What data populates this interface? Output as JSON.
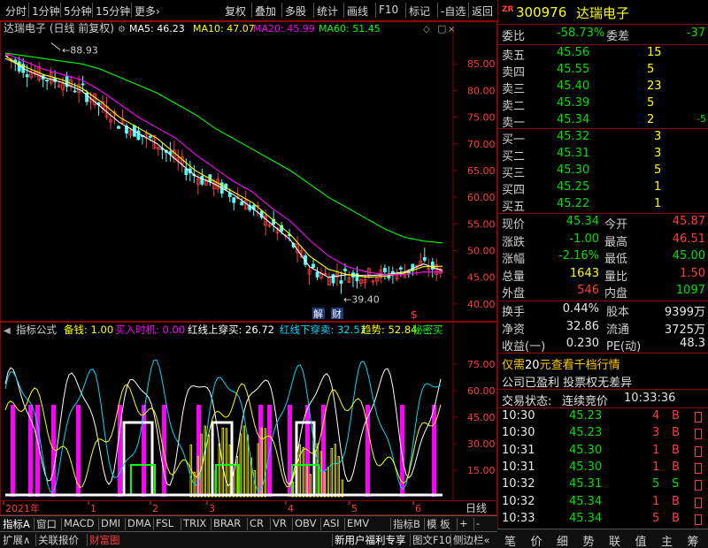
{
  "toolbar": {
    "items": [
      "分时",
      "1分钟",
      "5分钟",
      "15分钟",
      "更多›",
      "复权",
      "叠加",
      "多股",
      "统计",
      "画线",
      "F10",
      "标记",
      "-自选",
      "返回"
    ]
  },
  "kline": {
    "title": "达瑞电子 (日线 前复权)",
    "ma": [
      {
        "label": "MA5: 46.23",
        "color": "#ffffff"
      },
      {
        "label": "MA10: 47.07",
        "color": "#ffff00"
      },
      {
        "label": "MA20: 45.99",
        "color": "#ff00ff"
      },
      {
        "label": "MA60: 51.45",
        "color": "#00ff00"
      }
    ],
    "price_ticks": [
      "85.00",
      "80.00",
      "75.00",
      "70.00",
      "65.00",
      "60.00",
      "55.00",
      "50.00",
      "45.00",
      "40.00"
    ],
    "high_label": "88.93",
    "low_label": "39.40",
    "markers": [
      "解",
      "财",
      "$"
    ]
  },
  "chart_data": {
    "type": "line",
    "title": "达瑞电子 (日线 前复权)",
    "ylim": [
      38,
      90
    ],
    "x": [
      "2021年",
      "1",
      "2",
      "3",
      "4",
      "5",
      "6"
    ],
    "series": [
      {
        "name": "MA5",
        "values": [
          86.5,
          84,
          82.5,
          81.5,
          80,
          77,
          74,
          72,
          70,
          67,
          64,
          62.5,
          60.5,
          58,
          55,
          52,
          47,
          45,
          45.5,
          45.3,
          45.5,
          46,
          47.5,
          46.23
        ]
      },
      {
        "name": "MA10",
        "values": [
          86,
          84.5,
          83,
          82,
          80.5,
          78,
          75,
          73,
          71,
          68,
          65,
          63,
          61,
          59,
          56,
          53,
          49,
          46.5,
          45.5,
          45,
          45.2,
          45.8,
          47,
          47.07
        ]
      },
      {
        "name": "MA20",
        "values": [
          87,
          85.5,
          84,
          83,
          82,
          80,
          77.5,
          75,
          73,
          71,
          68,
          65.5,
          63,
          61,
          58,
          55.5,
          52,
          49,
          47,
          46,
          45.5,
          45.5,
          46,
          45.99
        ]
      },
      {
        "name": "MA60",
        "values": [
          87,
          86.5,
          86,
          85.5,
          85,
          84,
          82.5,
          81,
          79.5,
          77.5,
          75.5,
          73,
          71,
          69,
          67,
          65,
          62.5,
          60,
          58,
          56,
          54,
          52.5,
          51.8,
          51.45
        ]
      }
    ]
  },
  "indicator": {
    "name": "指标公式",
    "items": [
      {
        "label": "备钱: 1.00",
        "color": "#ffff00"
      },
      {
        "label": "买入时机: 0.00",
        "color": "#ff00ff"
      },
      {
        "label": "红线上穿买: 26.72",
        "color": "#ffffff"
      },
      {
        "label": "红线下穿卖: 32.51",
        "color": "#00d8ff"
      },
      {
        "label": "趋势: 52.84",
        "color": "#ffff00"
      },
      {
        "label": "秘密买",
        "color": "#00ff00"
      }
    ],
    "ticks": [
      "75.00",
      "60.00",
      "45.00",
      "30.00",
      "15.00"
    ]
  },
  "time_axis": {
    "labels": [
      "2021年",
      "1",
      "2",
      "3",
      "4",
      "5",
      "6"
    ],
    "period": "日线"
  },
  "bottom_tabs": [
    "指标A",
    "窗口",
    "MACD",
    "DMI",
    "DMA",
    "FSL",
    "TRIX",
    "BRAR",
    "CR",
    "VR",
    "OBV",
    "ASI",
    "EMV",
    "指标B",
    "模 板",
    "+",
    "-"
  ],
  "bottom_tabs2": [
    "扩展∧",
    "关联报价",
    "财富圈",
    "新用户福利专享",
    "图文F10",
    "侧边栏«"
  ],
  "quote": {
    "code": "300976",
    "name": "达瑞电子",
    "badge": "ZR",
    "weibi_label": "委比",
    "weibi": "-58.73%",
    "weicha_label": "委差",
    "weicha": "-37",
    "asks": [
      {
        "label": "卖五",
        "price": "45.56",
        "vol": "15",
        "chg": ""
      },
      {
        "label": "卖四",
        "price": "45.55",
        "vol": "5",
        "chg": ""
      },
      {
        "label": "卖三",
        "price": "45.40",
        "vol": "23",
        "chg": ""
      },
      {
        "label": "卖二",
        "price": "45.39",
        "vol": "5",
        "chg": ""
      },
      {
        "label": "卖一",
        "price": "45.34",
        "vol": "2",
        "chg": "-5"
      }
    ],
    "bids": [
      {
        "label": "买一",
        "price": "45.32",
        "vol": "3"
      },
      {
        "label": "买二",
        "price": "45.31",
        "vol": "3"
      },
      {
        "label": "买三",
        "price": "45.30",
        "vol": "5"
      },
      {
        "label": "买四",
        "price": "45.25",
        "vol": "1"
      },
      {
        "label": "买五",
        "price": "45.22",
        "vol": "1"
      }
    ],
    "stats": [
      {
        "l1": "现价",
        "v1": "45.34",
        "c1": "green",
        "l2": "今开",
        "v2": "45.87",
        "c2": "red"
      },
      {
        "l1": "涨跌",
        "v1": "-1.00",
        "c1": "green",
        "l2": "最高",
        "v2": "46.51",
        "c2": "red"
      },
      {
        "l1": "涨幅",
        "v1": "-2.16%",
        "c1": "green",
        "l2": "最低",
        "v2": "45.00",
        "c2": "green"
      },
      {
        "l1": "总量",
        "v1": "1643",
        "c1": "yellow",
        "l2": "量比",
        "v2": "1.50",
        "c2": "red"
      },
      {
        "l1": "外盘",
        "v1": "546",
        "c1": "red",
        "l2": "内盘",
        "v2": "1097",
        "c2": "green"
      }
    ],
    "stats2": [
      {
        "l1": "换手",
        "v1": "0.44%",
        "l2": "股本",
        "v2": "9399万"
      },
      {
        "l1": "净资",
        "v1": "32.86",
        "l2": "流通",
        "v2": "3725万"
      },
      {
        "l1": "收益(一)",
        "v1": "0.230",
        "l2": "PE(动)",
        "v2": "48.3"
      }
    ],
    "promo": "仅需20元查看千档行情",
    "promo_highlight": "20",
    "info": "公司已盈利 投票权无差异",
    "status_label": "交易状态:",
    "status": "连续竞价",
    "status_time": "10:33:36",
    "trades": [
      {
        "time": "10:30",
        "price": "45.23",
        "vol": "4",
        "side": "B"
      },
      {
        "time": "10:30",
        "price": "45.23",
        "vol": "3",
        "side": "B"
      },
      {
        "time": "10:31",
        "price": "45.30",
        "vol": "1",
        "side": "B"
      },
      {
        "time": "10:31",
        "price": "45.30",
        "vol": "1",
        "side": "B"
      },
      {
        "time": "10:32",
        "price": "45.31",
        "vol": "5",
        "side": "S"
      },
      {
        "time": "10:32",
        "price": "45.34",
        "vol": "1",
        "side": "B"
      },
      {
        "time": "10:33",
        "price": "45.34",
        "vol": "5",
        "side": "B"
      }
    ],
    "bottom_tabs": [
      "笔",
      "价",
      "细",
      "势",
      "联",
      "值",
      "主",
      "筹"
    ]
  }
}
